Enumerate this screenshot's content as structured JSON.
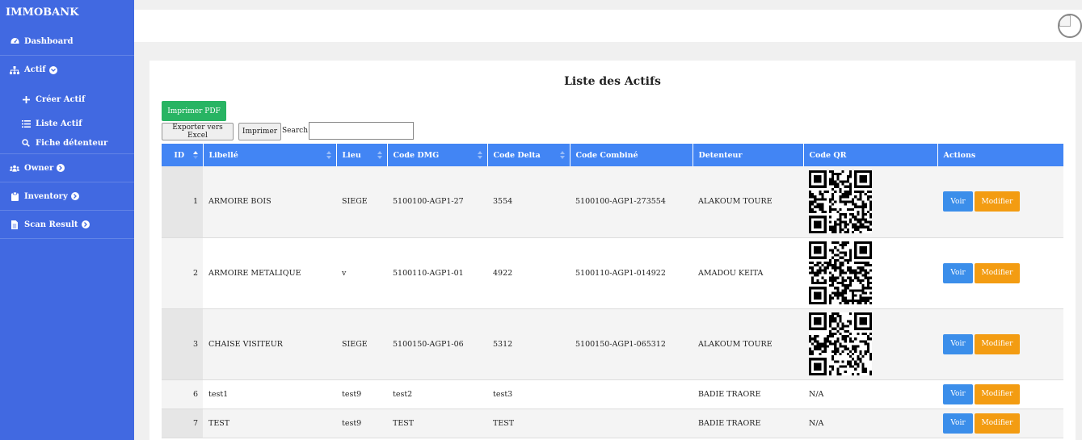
{
  "sidebar": {
    "brand": "IMMOBANK",
    "items": [
      {
        "label": "Dashboard",
        "icon": "gauge-icon"
      },
      {
        "label": "Actif",
        "icon": "sitemap-icon"
      },
      {
        "label": "Owner",
        "icon": "users-icon"
      },
      {
        "label": "Inventory",
        "icon": "clipboard-icon"
      },
      {
        "label": "Scan Result",
        "icon": "file-icon"
      }
    ],
    "subitems": [
      {
        "label": "Créer Actif",
        "icon": "plus-icon"
      },
      {
        "label": "Liste Actif",
        "icon": "list-icon"
      },
      {
        "label": "Fiche détenteur",
        "icon": "search-icon"
      }
    ]
  },
  "page": {
    "title": "Liste des Actifs",
    "pdf_label": "Imprimer PDF",
    "excel_label": "Exporter vers Excel",
    "print_label": "Imprimer",
    "search_label": "Search:",
    "search_value": ""
  },
  "table": {
    "headers": [
      "ID",
      "Libellé",
      "Lieu",
      "Code DMG",
      "Code Delta",
      "Code Combiné",
      "Detenteur",
      "Code QR",
      "Actions"
    ],
    "view_label": "Voir",
    "edit_label": "Modifier",
    "rows": [
      {
        "id": "1",
        "libelle": "ARMOIRE BOIS",
        "lieu": "SIEGE",
        "dmg": "5100100-AGP1-27",
        "delta": "3554",
        "combine": "5100100-AGP1-273554",
        "detenteur": "ALAKOUM TOURE",
        "qr": ""
      },
      {
        "id": "2",
        "libelle": "ARMOIRE METALIQUE",
        "lieu": "v",
        "dmg": "5100110-AGP1-01",
        "delta": "4922",
        "combine": "5100110-AGP1-014922",
        "detenteur": "AMADOU KEITA",
        "qr": ""
      },
      {
        "id": "3",
        "libelle": "CHAISE VISITEUR",
        "lieu": "SIEGE",
        "dmg": "5100150-AGP1-06",
        "delta": "5312",
        "combine": "5100150-AGP1-065312",
        "detenteur": "ALAKOUM TOURE",
        "qr": ""
      },
      {
        "id": "6",
        "libelle": "test1",
        "lieu": "test9",
        "dmg": "test2",
        "delta": "test3",
        "combine": "",
        "detenteur": "BADIE TRAORE",
        "qr": "N/A"
      },
      {
        "id": "7",
        "libelle": "TEST",
        "lieu": "test9",
        "dmg": "TEST",
        "delta": "TEST",
        "combine": "",
        "detenteur": "BADIE TRAORE",
        "qr": "N/A"
      }
    ]
  },
  "colors": {
    "sidebar": "#4169e1",
    "header": "#4285f4",
    "view_button": "#3b8eea",
    "edit_button": "#f39c12",
    "pdf_button": "#28b463"
  }
}
